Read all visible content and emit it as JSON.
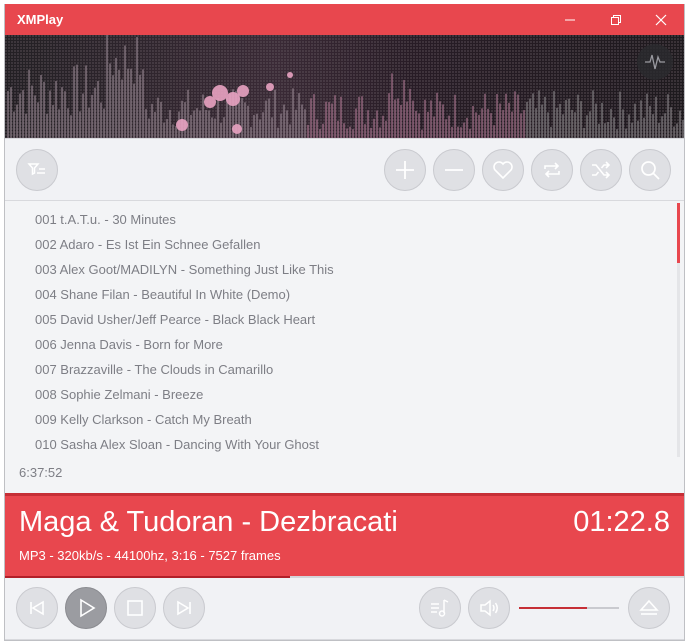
{
  "window": {
    "title": "XMPlay",
    "controls": {
      "minimize": "minimize-icon",
      "restore": "restore-icon",
      "close": "close-icon"
    }
  },
  "toolbar": {
    "left_buttons": [
      {
        "name": "playlist-filter-button",
        "icon": "filter-list-icon"
      }
    ],
    "right_buttons": [
      {
        "name": "add-button",
        "icon": "plus-icon"
      },
      {
        "name": "remove-button",
        "icon": "minus-icon"
      },
      {
        "name": "favorite-button",
        "icon": "heart-icon"
      },
      {
        "name": "repeat-button",
        "icon": "repeat-icon"
      },
      {
        "name": "shuffle-button",
        "icon": "shuffle-icon"
      },
      {
        "name": "search-button",
        "icon": "search-icon"
      }
    ]
  },
  "playlist": {
    "tracks": [
      "001 t.A.T.u. - 30 Minutes",
      "002 Adaro - Es Ist Ein Schnee Gefallen",
      "003 Alex Goot/MADILYN - Something Just Like This",
      "004 Shane Filan - Beautiful In White (Demo)",
      "005 David Usher/Jeff Pearce - Black Black Heart",
      "006 Jenna Davis - Born for More",
      "007 Brazzaville - The Clouds in Camarillo",
      "008 Sophie Zelmani - Breeze",
      "009 Kelly Clarkson - Catch My Breath",
      "010 Sasha Alex Sloan - Dancing With Your Ghost"
    ],
    "total_time": "6:37:52"
  },
  "now_playing": {
    "title": "Maga & Tudoran - Dezbracati",
    "elapsed": "01:22.8",
    "info": "MP3 - 320kb/s - 44100hz, 3:16 - 7527 frames",
    "progress_fraction": 0.42
  },
  "controls": {
    "transport": [
      {
        "name": "previous-button",
        "icon": "previous-icon"
      },
      {
        "name": "play-button",
        "icon": "play-icon"
      },
      {
        "name": "stop-button",
        "icon": "stop-icon"
      },
      {
        "name": "next-button",
        "icon": "next-icon"
      }
    ],
    "right": [
      {
        "name": "playlist-toggle-button",
        "icon": "playlist-note-icon"
      },
      {
        "name": "mute-button",
        "icon": "speaker-icon"
      },
      {
        "name": "eject-button",
        "icon": "eject-icon"
      }
    ],
    "volume_fraction": 0.68
  },
  "colors": {
    "accent": "#e8474e",
    "accent_dark": "#c62f36",
    "panel": "#f1f2f5"
  }
}
